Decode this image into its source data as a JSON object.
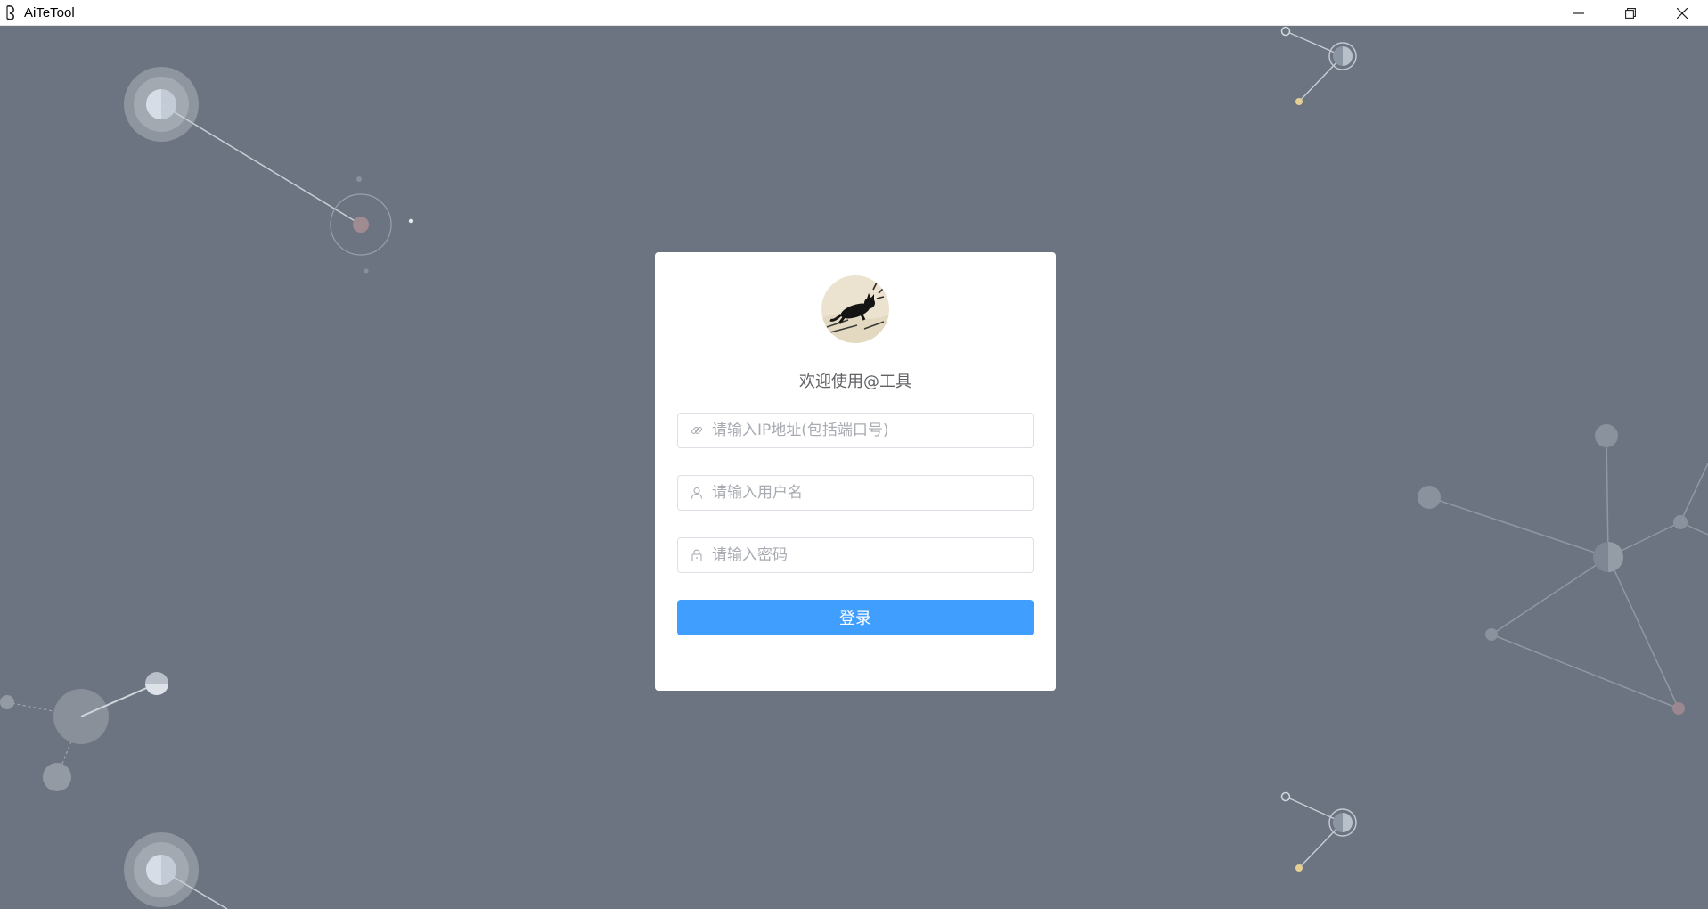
{
  "window": {
    "title": "AiTeTool",
    "controls": [
      "minimize-icon",
      "restore-icon",
      "close-icon"
    ]
  },
  "login": {
    "welcome": "欢迎使用@工具",
    "ip_placeholder": "请输入IP地址(包括端口号)",
    "username_placeholder": "请输入用户名",
    "password_placeholder": "请输入密码",
    "submit_label": "登录"
  },
  "icons": {
    "ip": "link-icon",
    "username": "user-icon",
    "password": "lock-icon"
  },
  "colors": {
    "background": "#6b7480",
    "card": "#ffffff",
    "primary": "#409eff",
    "input_border": "#dcdfe6",
    "placeholder": "#a8abb2",
    "welcome_text": "#606266"
  }
}
